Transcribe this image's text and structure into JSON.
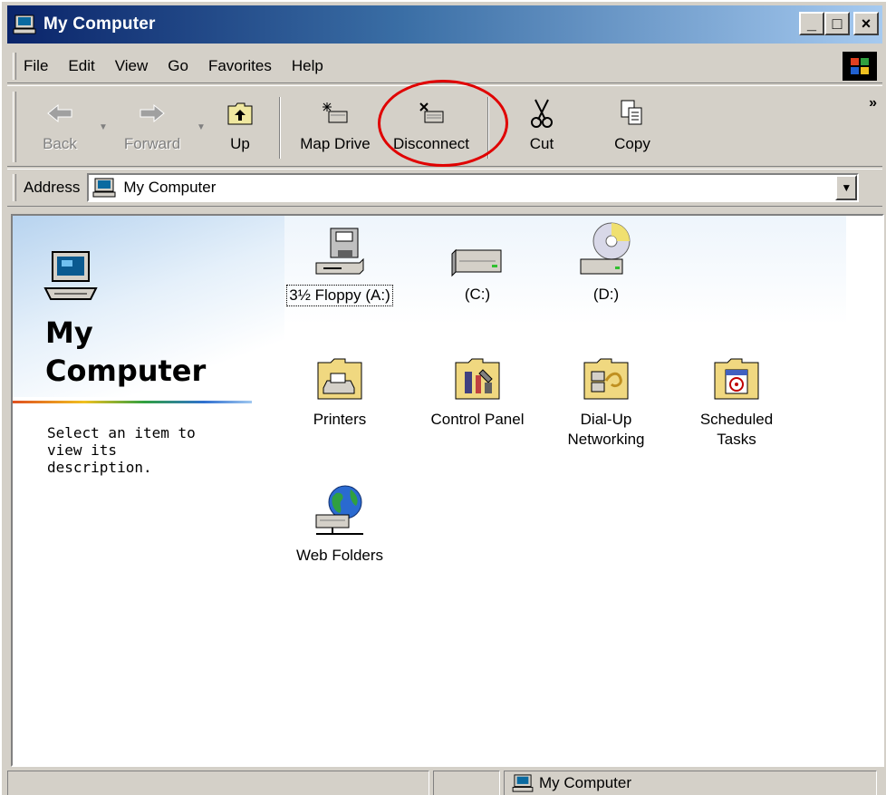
{
  "window": {
    "title": "My Computer",
    "minimize_glyph": "_",
    "maximize_glyph": "□",
    "close_glyph": "×"
  },
  "menu": [
    {
      "label": "File"
    },
    {
      "label": "Edit"
    },
    {
      "label": "View"
    },
    {
      "label": "Go"
    },
    {
      "label": "Favorites"
    },
    {
      "label": "Help"
    }
  ],
  "toolbar": {
    "back_label": "Back",
    "forward_label": "Forward",
    "up_label": "Up",
    "map_drive_label": "Map Drive",
    "disconnect_label": "Disconnect",
    "cut_label": "Cut",
    "copy_label": "Copy",
    "more_glyph": "»"
  },
  "address": {
    "label": "Address",
    "value": "My Computer"
  },
  "sidebar": {
    "title_line1": "My",
    "title_line2": "Computer",
    "description": "Select an item to view its description."
  },
  "items": {
    "floppy": "3½ Floppy (A:)",
    "c_drive": "(C:)",
    "d_drive": "(D:)",
    "printers": "Printers",
    "control_panel": "Control Panel",
    "dialup_line1": "Dial-Up",
    "dialup_line2": "Networking",
    "scheduled_line1": "Scheduled",
    "scheduled_line2": "Tasks",
    "web_folders": "Web Folders"
  },
  "status": {
    "location": "My Computer"
  },
  "colors": {
    "titlebar_start": "#0a246a",
    "titlebar_end": "#a6caf0",
    "highlight_circle": "#e00000",
    "chrome": "#d4d0c8"
  }
}
